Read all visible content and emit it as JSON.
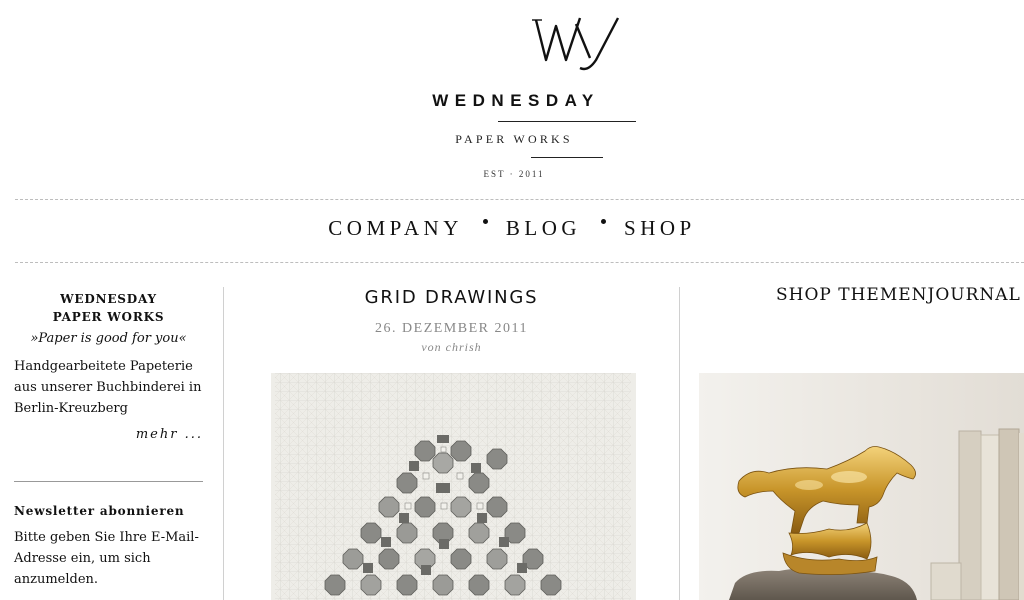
{
  "header": {
    "logo_title": "WEDNESDAY",
    "logo_subtitle": "PAPER WORKS",
    "logo_est": "EST · 2011"
  },
  "nav": {
    "items": [
      {
        "label": "COMPANY"
      },
      {
        "label": "BLOG"
      },
      {
        "label": "SHOP"
      }
    ]
  },
  "sidebar": {
    "heading_line1": "WEDNESDAY",
    "heading_line2": "PAPER WORKS",
    "tagline": "»Paper is good for you«",
    "description": "Handgearbeitete Papeterie aus unserer Buchbinderei in Berlin-Kreuzberg",
    "more_link": "mehr ...",
    "newsletter_title": "Newsletter abonnieren",
    "newsletter_text": "Bitte geben Sie Ihre E-Mail-Adresse ein, um sich anzumelden."
  },
  "post": {
    "title": "GRID DRAWINGS",
    "date": "26. DEZEMBER 2011",
    "author": "von chrish"
  },
  "shop": {
    "title": "SHOP THEMENJOURNAL"
  }
}
